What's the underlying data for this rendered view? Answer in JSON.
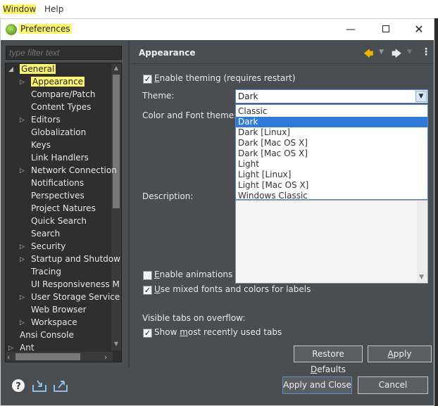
{
  "menubar": {
    "items": [
      "Window",
      "Help"
    ]
  },
  "dialog": {
    "title": "Preferences",
    "window_controls": {
      "minimize": "—",
      "maximize": "",
      "close": "✕"
    }
  },
  "filter": {
    "placeholder": "type filter text"
  },
  "tree": {
    "items": [
      {
        "label": "General",
        "level": 0,
        "twisty": "expanded"
      },
      {
        "label": "Appearance",
        "level": 1,
        "twisty": "collapsed",
        "selected": true
      },
      {
        "label": "Compare/Patch",
        "level": 1,
        "twisty": "none"
      },
      {
        "label": "Content Types",
        "level": 1,
        "twisty": "none"
      },
      {
        "label": "Editors",
        "level": 1,
        "twisty": "collapsed"
      },
      {
        "label": "Globalization",
        "level": 1,
        "twisty": "none"
      },
      {
        "label": "Keys",
        "level": 1,
        "twisty": "none"
      },
      {
        "label": "Link Handlers",
        "level": 1,
        "twisty": "none"
      },
      {
        "label": "Network Connection",
        "level": 1,
        "twisty": "collapsed"
      },
      {
        "label": "Notifications",
        "level": 1,
        "twisty": "none"
      },
      {
        "label": "Perspectives",
        "level": 1,
        "twisty": "none"
      },
      {
        "label": "Project Natures",
        "level": 1,
        "twisty": "none"
      },
      {
        "label": "Quick Search",
        "level": 1,
        "twisty": "none"
      },
      {
        "label": "Search",
        "level": 1,
        "twisty": "none"
      },
      {
        "label": "Security",
        "level": 1,
        "twisty": "collapsed"
      },
      {
        "label": "Startup and Shutdow",
        "level": 1,
        "twisty": "collapsed"
      },
      {
        "label": "Tracing",
        "level": 1,
        "twisty": "none"
      },
      {
        "label": "UI Responsiveness M",
        "level": 1,
        "twisty": "none"
      },
      {
        "label": "User Storage Service",
        "level": 1,
        "twisty": "collapsed"
      },
      {
        "label": "Web Browser",
        "level": 1,
        "twisty": "none"
      },
      {
        "label": "Workspace",
        "level": 1,
        "twisty": "collapsed"
      },
      {
        "label": "Ansi Console",
        "level": 0,
        "twisty": "none"
      },
      {
        "label": "Ant",
        "level": 0,
        "twisty": "collapsed"
      }
    ]
  },
  "page": {
    "title": "Appearance",
    "enable_theming": {
      "label_pre": "",
      "mnemonic": "E",
      "label_post": "nable theming (requires restart)",
      "checked": true
    },
    "theme_label": "Theme:",
    "theme_value": "Dark",
    "theme_options": [
      "Classic",
      "Dark",
      "Dark [Linux]",
      "Dark [Mac OS X]",
      "Dark [Mac OS X]",
      "Light",
      "Light [Linux]",
      "Light [Mac OS X]",
      "Windows Classic"
    ],
    "theme_selected_index": 1,
    "color_font_label": "Color and Font theme:",
    "description_label": "Description:",
    "enable_animations": {
      "mnemonic": "E",
      "label_post": "nable animations",
      "checked": false
    },
    "mixed_fonts": {
      "mnemonic": "U",
      "label_post": "se mixed fonts and colors for labels",
      "checked": true
    },
    "visible_tabs_label": "Visible tabs on overflow:",
    "show_recent": {
      "label_pre": "Show ",
      "mnemonic": "m",
      "label_post": "ost recently used tabs",
      "checked": true
    }
  },
  "buttons": {
    "restore_pre": "Restore ",
    "restore_mn": "D",
    "restore_post": "efaults",
    "apply_mn": "A",
    "apply_post": "pply",
    "apply_close": "Apply and Close",
    "cancel": "Cancel"
  },
  "icons": {
    "back": "🡄",
    "forward": "🡆",
    "menu": "⋮",
    "help": "?",
    "import": "import-icon",
    "export": "export-icon"
  },
  "colors": {
    "highlight": "#fff56a",
    "selection": "#2f7ad9",
    "back_arrow": "#f0b400"
  }
}
